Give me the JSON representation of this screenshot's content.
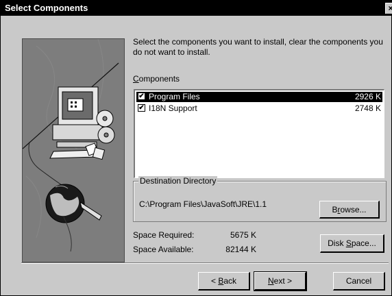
{
  "window": {
    "title": "Select Components",
    "close_glyph": "×"
  },
  "intro_text": "Select the components you want to install, clear the components you do not want to install.",
  "components": {
    "label_underlined": "C",
    "label_rest": "omponents",
    "items": [
      {
        "name": "Program Files",
        "size": "2926 K",
        "checked": true,
        "selected": true
      },
      {
        "name": "I18N Support",
        "size": "2748 K",
        "checked": true,
        "selected": false
      }
    ]
  },
  "destination": {
    "legend": "Destination Directory",
    "path": "C:\\Program Files\\JavaSoft\\JRE\\1.1",
    "browse_pre": "B",
    "browse_u": "r",
    "browse_post": "owse..."
  },
  "space": {
    "required_label": "Space Required:",
    "required_value": "5675 K",
    "available_label": "Space Available:",
    "available_value": "82144 K",
    "disk_pre": "Disk ",
    "disk_u": "S",
    "disk_post": "pace..."
  },
  "buttons": {
    "back_pre": "< ",
    "back_u": "B",
    "back_post": "ack",
    "next_u": "N",
    "next_post": "ext >",
    "cancel": "Cancel"
  },
  "icons": [
    "computer-icon",
    "cd-disc-icon",
    "floppy-disk-icon",
    "globe-icon",
    "checkbox-checked-icon",
    "close-icon"
  ],
  "colors": {
    "window_bg": "#c9c9c9",
    "titlebar_bg": "#000000",
    "selection_bg": "#000000",
    "art_bg": "#7d7d7d"
  }
}
